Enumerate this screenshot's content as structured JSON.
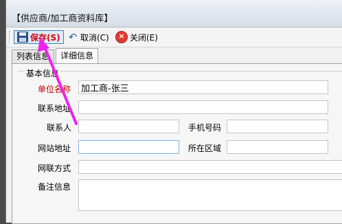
{
  "window": {
    "title": "【供应商/加工商资料库】"
  },
  "toolbar": {
    "save_label": "保存(S)",
    "cancel_label": "取消(C)",
    "close_label": "关闭(E)"
  },
  "tabs": [
    {
      "label": "列表信息"
    },
    {
      "label": "详细信息"
    }
  ],
  "form": {
    "group_title": "基本信息",
    "unit_name_label": "单位名称",
    "unit_name_value": "加工商-张三",
    "address_label": "联系地址",
    "address_value": "",
    "contact_label": "联系人",
    "contact_value": "",
    "mobile_label": "手机号码",
    "mobile_value": "",
    "website_label": "网站地址",
    "website_value": "",
    "region_label": "所在区域",
    "region_value": "",
    "im_label": "网联方式",
    "im_value": "",
    "remark_label": "备注信息",
    "remark_value": ""
  },
  "colors": {
    "required_label": "#c00000",
    "save_text": "#d8000c",
    "annotation_arrow": "#ee22ee"
  }
}
